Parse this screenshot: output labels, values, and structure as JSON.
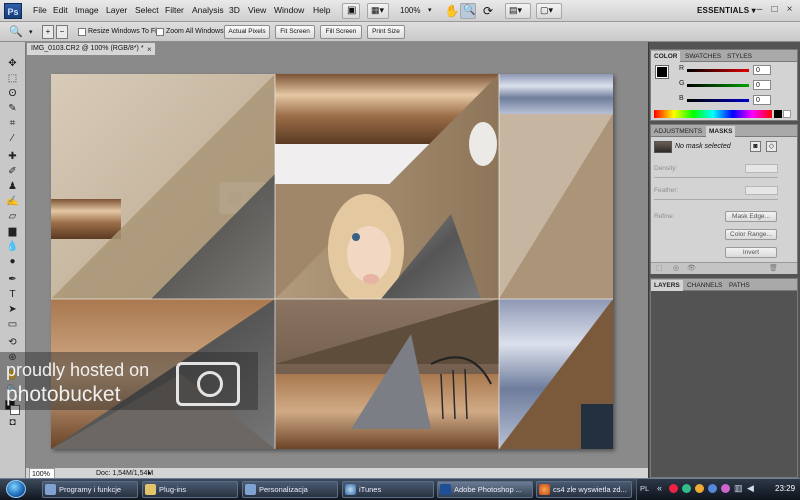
{
  "app": {
    "logo": "Ps",
    "zoom": "100%",
    "workspace": "ESSENTIALS ▾"
  },
  "menu": [
    "File",
    "Edit",
    "Image",
    "Layer",
    "Select",
    "Filter",
    "Analysis",
    "3D",
    "View",
    "Window",
    "Help"
  ],
  "options_bar": {
    "resize_windows": "Resize Windows To Fit",
    "zoom_all": "Zoom All Windows",
    "btn_actual": "Actual Pixels",
    "btn_fit": "Fit Screen",
    "btn_fill": "Fill Screen",
    "btn_print": "Print Size"
  },
  "document": {
    "tab_title": "IMG_0103.CR2 @ 100% (RGB/8*) *",
    "status_zoom": "100%",
    "status_doc": "Doc: 1,54M/1,54M"
  },
  "color_panel": {
    "tabs": [
      "COLOR",
      "SWATCHES",
      "STYLES"
    ],
    "r_label": "R",
    "g_label": "G",
    "b_label": "B",
    "r_value": "0",
    "g_value": "0",
    "b_value": "0"
  },
  "masks_panel": {
    "tabs": [
      "ADJUSTMENTS",
      "MASKS"
    ],
    "no_mask": "No mask selected",
    "density": "Density:",
    "feather": "Feather:",
    "refine": "Refine:",
    "mask_edge": "Mask Edge...",
    "color_range": "Color Range...",
    "invert": "Invert"
  },
  "layers_panel": {
    "tabs": [
      "LAYERS",
      "CHANNELS",
      "PATHS"
    ]
  },
  "taskbar": {
    "tasks": [
      "Programy i funkcje",
      "Plug-ins",
      "Personalizacja",
      "iTunes",
      "Adobe Photoshop ...",
      "cs4 zle wyswietla zd..."
    ],
    "lang": "PL",
    "clock": "23:29"
  },
  "watermark": {
    "line1": "proudly hosted on",
    "line2": "photobucket"
  },
  "colors": {
    "ui_dark": "#535353",
    "panel_bg": "#d3d3d3",
    "slider_red": "#e00000",
    "slider_green": "#00a000",
    "slider_blue": "#0000c8"
  }
}
